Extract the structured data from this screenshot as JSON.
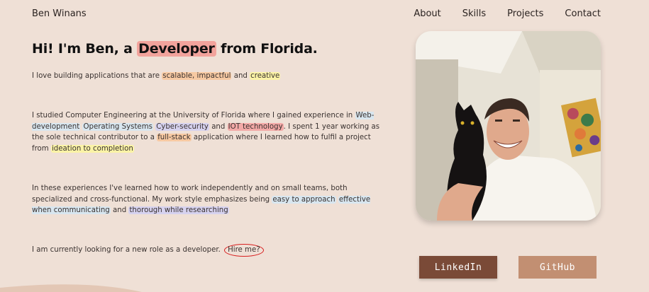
{
  "brand": "Ben Winans",
  "nav": {
    "about": "About",
    "skills": "Skills",
    "projects": "Projects",
    "contact": "Contact"
  },
  "hero": {
    "headline_pre": "Hi! I'm Ben, a ",
    "headline_highlight": "Developer",
    "headline_post": " from Florida."
  },
  "para1": {
    "pre": "I love building applications that are ",
    "tag1": "scalable, impactful",
    "mid": " and ",
    "tag2": "creative"
  },
  "para2": {
    "pre": "I studied Computer Engineering at the University of Florida where I gained experience in ",
    "tag_web": "Web-development",
    "tag_os": "Operating Systems",
    "tag_cyber": "Cyber-security",
    "and": " and ",
    "tag_iot": "IOT technology",
    "mid": ". I spent 1 year working as the sole technical contributor to a ",
    "tag_fullstack": "full-stack",
    "mid2": " application where I learned how to fulfil a project from ",
    "tag_ideation": "ideation to completion"
  },
  "para3": {
    "pre": "In these experiences I've learned how to work independently and on small teams, both specialized and cross-functional. My work style emphasizes being ",
    "tag1": "easy to approach",
    "tag2": "effective when communicating",
    "and": " and ",
    "tag3": "thorough while researching"
  },
  "para4": {
    "pre": "I am currently looking for a new role as a developer. ",
    "hire": "Hire me?"
  },
  "buttons": {
    "linkedin": "LinkedIn",
    "github": "GitHub"
  },
  "colors": {
    "background": "#efe0d6",
    "linkedin": "#7a4a37",
    "github": "#c28f72",
    "highlight_pink": "#f2a39c",
    "circle_red": "#d71f1f"
  }
}
